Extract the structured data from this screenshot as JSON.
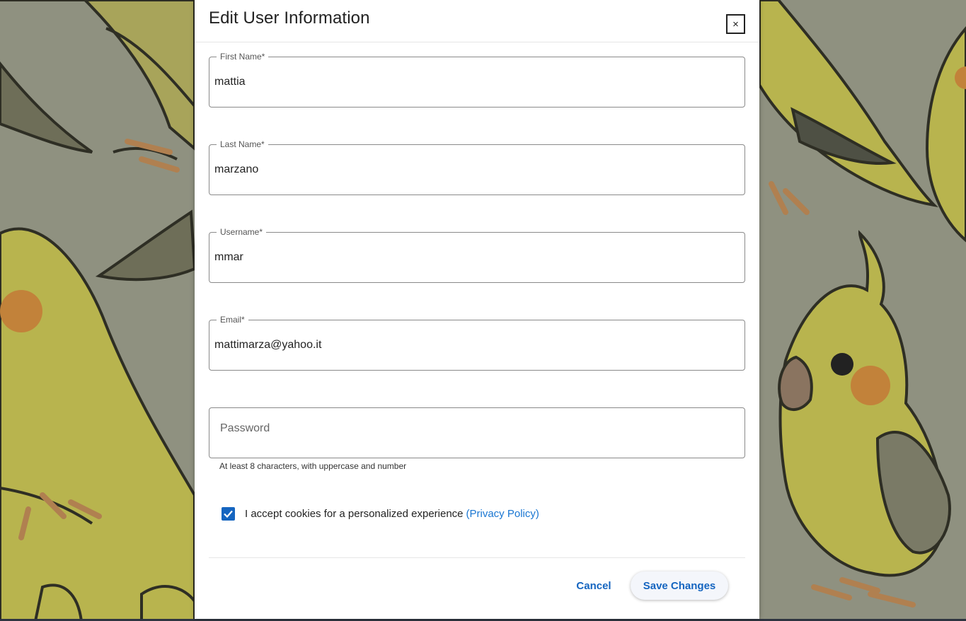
{
  "dialog": {
    "title": "Edit User Information",
    "close_label": "×"
  },
  "form": {
    "first_name": {
      "label": "First Name*",
      "value": "mattia"
    },
    "last_name": {
      "label": "Last Name*",
      "value": "marzano"
    },
    "username": {
      "label": "Username*",
      "value": "mmar"
    },
    "email": {
      "label": "Email*",
      "value": "mattimarza@yahoo.it"
    },
    "password": {
      "placeholder": "Password",
      "value": "",
      "helper": "At least 8 characters, with uppercase and number"
    },
    "consent": {
      "checked": true,
      "text": "I accept cookies for a personalized experience",
      "link": "(Privacy Policy)"
    }
  },
  "actions": {
    "cancel_label": "Cancel",
    "save_label": "Save Changes"
  },
  "colors": {
    "accent": "#1565c0",
    "link": "#1976d2",
    "backdrop": "#8f9180"
  },
  "icons": {
    "close": "close-icon",
    "check": "check-icon"
  }
}
